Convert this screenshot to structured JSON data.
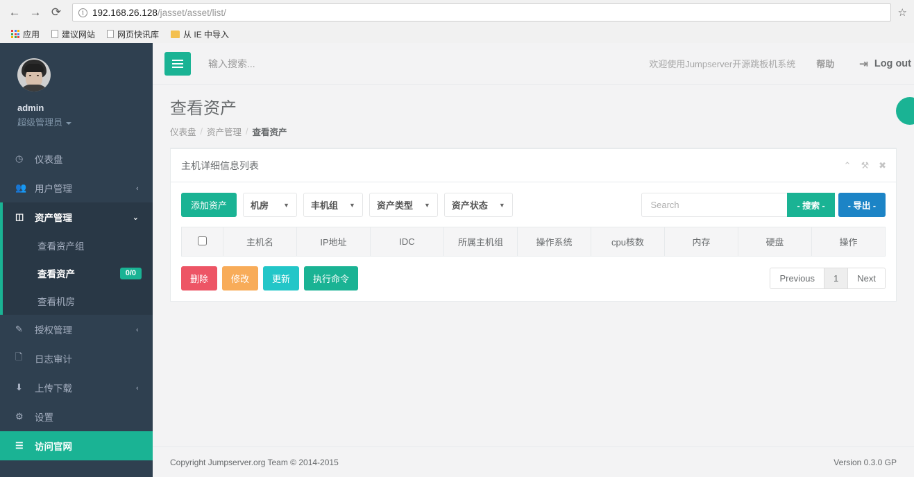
{
  "browser": {
    "back_icon": "←",
    "forward_icon": "→",
    "reload_icon": "⟳",
    "url_host": "192.168.26.128",
    "url_path": "/jasset/asset/list/",
    "star_icon": "☆",
    "bookmarks": [
      {
        "label": "应用",
        "icon": "apps-grid-icon"
      },
      {
        "label": "建议网站",
        "icon": "document-icon"
      },
      {
        "label": "网页快讯库",
        "icon": "document-icon"
      },
      {
        "label": "从 IE 中导入",
        "icon": "folder-icon"
      }
    ]
  },
  "sidebar": {
    "profile": {
      "username": "admin",
      "role": "超级管理员"
    },
    "items": [
      {
        "label": "仪表盘",
        "icon": "dashboard-icon",
        "arrow": ""
      },
      {
        "label": "用户管理",
        "icon": "users-icon",
        "arrow": "‹"
      },
      {
        "label": "资产管理",
        "icon": "box-icon",
        "arrow": "⌄"
      },
      {
        "label": "授权管理",
        "icon": "edit-icon",
        "arrow": "‹"
      },
      {
        "label": "日志审计",
        "icon": "copy-icon",
        "arrow": ""
      },
      {
        "label": "上传下载",
        "icon": "download-icon",
        "arrow": "‹"
      },
      {
        "label": "设置",
        "icon": "gear-icon",
        "arrow": ""
      },
      {
        "label": "访问官网",
        "icon": "server-icon",
        "arrow": ""
      }
    ],
    "submenu": [
      {
        "label": "查看资产组",
        "badge": ""
      },
      {
        "label": "查看资产",
        "badge": "0/0"
      },
      {
        "label": "查看机房",
        "badge": ""
      }
    ]
  },
  "topnav": {
    "hamburger_icon": "hamburger-icon",
    "search_placeholder": "输入搜索...",
    "welcome": "欢迎使用Jumpserver开源跳板机系统",
    "help": "帮助",
    "logout_icon": "sign-out-icon",
    "logout": "Log out"
  },
  "page": {
    "title": "查看资产",
    "breadcrumb": [
      "仪表盘",
      "资产管理",
      "查看资产"
    ],
    "breadcrumb_sep": "/"
  },
  "panel": {
    "title": "主机详细信息列表",
    "tools": [
      {
        "icon": "chevron-up-icon",
        "glyph": "⌃"
      },
      {
        "icon": "wrench-icon",
        "glyph": "🔧"
      },
      {
        "icon": "close-icon",
        "glyph": "✖"
      }
    ]
  },
  "toolbar": {
    "add_label": "添加资产",
    "filters": [
      {
        "label": "机房",
        "caret": "▼"
      },
      {
        "label": "丰机组",
        "caret": "▼"
      },
      {
        "label": "资产类型",
        "caret": "▼"
      },
      {
        "label": "资产状态",
        "caret": "▼"
      }
    ],
    "search_placeholder": "Search",
    "search_value": "",
    "search_label": "- 搜索 -",
    "export_label": "- 导出 -"
  },
  "table": {
    "columns": [
      "主机名",
      "IP地址",
      "IDC",
      "所属主机组",
      "操作系统",
      "cpu核数",
      "内存",
      "硬盘",
      "操作"
    ],
    "rows": []
  },
  "actions": {
    "delete": "删除",
    "edit": "修改",
    "update": "更新",
    "exec": "执行命令"
  },
  "pagination": {
    "previous": "Previous",
    "current": "1",
    "next": "Next"
  },
  "footer": {
    "copyright": "Copyright Jumpserver.org Team © 2014-2015",
    "version": "Version 0.3.0 GP"
  },
  "colors": {
    "primary_green": "#1ab394",
    "sidebar_bg": "#2f4050",
    "submenu_bg": "#293846",
    "blue": "#1c84c6",
    "red": "#ed5565",
    "orange": "#f8ac59",
    "cyan": "#23c6c8"
  }
}
